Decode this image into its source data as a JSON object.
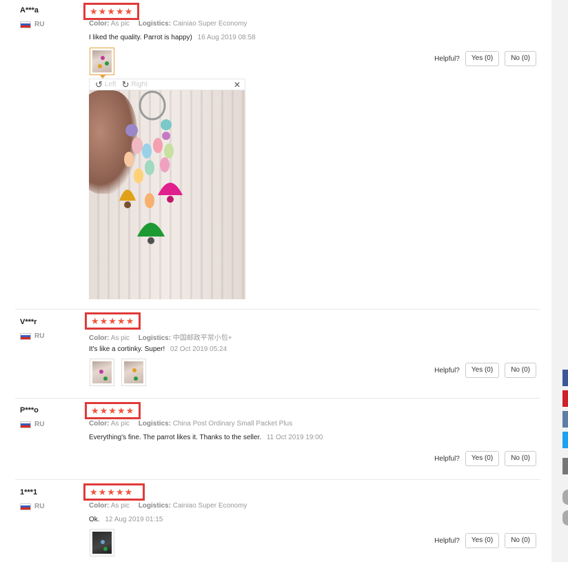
{
  "labels": {
    "color": "Color:",
    "logistics": "Logistics:",
    "helpful": "Helpful?",
    "yes": "Yes (0)",
    "no": "No (0)",
    "viewer_left": "Left",
    "viewer_right": "Right"
  },
  "reviews": [
    {
      "user": "A***a",
      "country": "RU",
      "rating": 5,
      "stars": "★★★★★",
      "color": "As pic",
      "logistics": "Cainiao Super Economy",
      "text": "I liked the quality. Parrot is happy)",
      "date": "16 Aug 2019 08:58"
    },
    {
      "user": "V***r",
      "country": "RU",
      "rating": 5,
      "stars": "★★★★★",
      "color": "As pic",
      "logistics": "中国邮政平常小包+",
      "text": "It's like a cortinky. Super!",
      "date": "02 Oct 2019 05:24"
    },
    {
      "user": "P***o",
      "country": "RU",
      "rating": 5,
      "stars": "★★★★★",
      "color": "As pic",
      "logistics": "China Post Ordinary Small Packet Plus",
      "text": "Everything's fine. The parrot likes it. Thanks to the seller.",
      "date": "11 Oct 2019 19:00"
    },
    {
      "user": "1***1",
      "country": "RU",
      "rating": 5,
      "stars": "★★★★★",
      "color": "As pic",
      "logistics": "Cainiao Super Economy",
      "text": "Ok.",
      "date": "12 Aug 2019 01:15"
    }
  ],
  "colors": {
    "star": "#f2543d",
    "highlight_box": "#e03a3a",
    "active_thumb": "#e6a23c",
    "share_colors": [
      "#3b5998",
      "#cc2127",
      "#5b7fa6",
      "#1da1f2",
      "#777777"
    ]
  },
  "icons": {
    "rotate_left": "rotate-left-icon",
    "rotate_right": "rotate-right-icon",
    "close": "close-icon"
  }
}
